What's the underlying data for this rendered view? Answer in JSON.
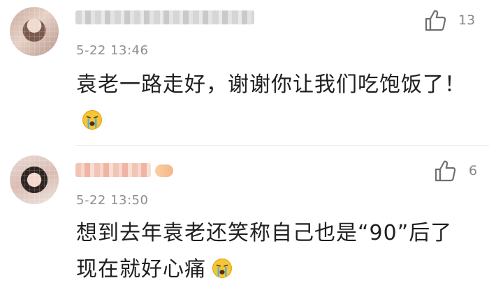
{
  "comments": [
    {
      "timestamp": "5-22 13:46",
      "likes": "13",
      "text": "袁老一路走好，谢谢你让我们吃饱饭了！",
      "emoji": "crying-face-icon"
    },
    {
      "timestamp": "5-22 13:50",
      "likes": "6",
      "text": "想到去年袁老还笑称自己也是“90”后了现在就好心痛",
      "emoji": "crying-face-icon"
    }
  ],
  "colors": {
    "text": "#1f1f1f",
    "meta": "#8d8d8d",
    "divider": "#ececec",
    "emoji_face": "#f7c531"
  }
}
